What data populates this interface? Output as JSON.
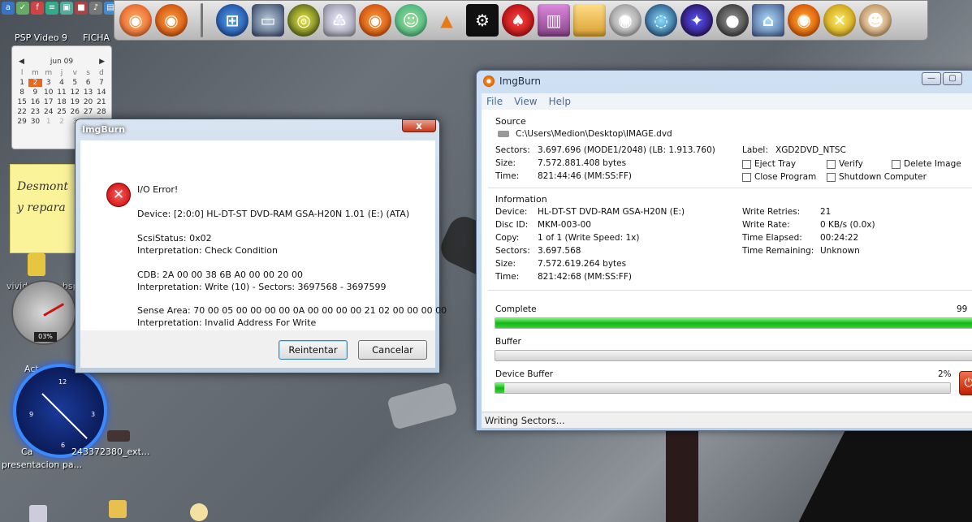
{
  "desktop": {
    "labels": {
      "psp_video": "PSP Video 9",
      "ficha": "FICHA",
      "vivid": "vivid_mgic...bsp",
      "act": "Act",
      "ca": "Ca",
      "file_ext": "243372380_ext...",
      "presentacion": "presentacion pa..."
    },
    "sticky_note": {
      "line1": "Desmont",
      "line2": "y repara"
    },
    "meter_value": "03%",
    "calendar": {
      "month": "jun 09",
      "days_of_week": [
        "l",
        "m",
        "m",
        "j",
        "v",
        "s",
        "d"
      ],
      "weeks": [
        [
          "1",
          "2",
          "3",
          "4",
          "5",
          "6",
          "7"
        ],
        [
          "8",
          "9",
          "10",
          "11",
          "12",
          "13",
          "14"
        ],
        [
          "15",
          "16",
          "17",
          "18",
          "19",
          "20",
          "21"
        ],
        [
          "22",
          "23",
          "24",
          "25",
          "26",
          "27",
          "28"
        ],
        [
          "29",
          "30",
          "1",
          "2",
          "3",
          "4",
          "5"
        ]
      ],
      "today": "2"
    },
    "dock_icons": [
      "firefox-orange-icon",
      "firefox-icon",
      "windows-start-icon",
      "computer-icon",
      "media-icon",
      "recycle-bin-icon",
      "firefox-alt-icon",
      "messenger-icon",
      "vlc-icon",
      "steam-icon",
      "poker-icon",
      "winrar-icon",
      "folder-icon",
      "disc-tool-icon",
      "swirl-icon",
      "games-icon",
      "webcam-icon",
      "network-icon",
      "burner-icon",
      "tools-icon",
      "cow-icon"
    ]
  },
  "imgburn": {
    "title": "ImgBurn",
    "menu": [
      "File",
      "View",
      "Help"
    ],
    "source": {
      "heading": "Source",
      "path": "C:\\Users\\Medion\\Desktop\\IMAGE.dvd",
      "sectors_label": "Sectors:",
      "sectors_value": "3.697.696 (MODE1/2048) (LB: 1.913.760)",
      "size_label": "Size:",
      "size_value": "7.572.881.408 bytes",
      "time_label": "Time:",
      "time_value": "821:44:46 (MM:SS:FF)",
      "disc_label_label": "Label:",
      "disc_label_value": "XGD2DVD_NTSC",
      "options": [
        "Eject Tray",
        "Verify",
        "Delete Image",
        "Close Program",
        "Shutdown Computer"
      ]
    },
    "information": {
      "heading": "Information",
      "device_label": "Device:",
      "device_value": "HL-DT-ST DVD-RAM GSA-H20N (E:)",
      "discid_label": "Disc ID:",
      "discid_value": "MKM-003-00",
      "copy_label": "Copy:",
      "copy_value": "1 of 1 (Write Speed: 1x)",
      "sectors_label": "Sectors:",
      "sectors_value": "3.697.568",
      "size_label": "Size:",
      "size_value": "7.572.619.264 bytes",
      "time_label": "Time:",
      "time_value": "821:42:68 (MM:SS:FF)",
      "retries_label": "Write Retries:",
      "retries_value": "21",
      "rate_label": "Write Rate:",
      "rate_value": "0 KB/s (0.0x)",
      "elapsed_label": "Time Elapsed:",
      "elapsed_value": "00:24:22",
      "remaining_label": "Time Remaining:",
      "remaining_value": "Unknown"
    },
    "progress": {
      "complete_label": "Complete",
      "complete_pct_text": "99",
      "complete_value": 0.99,
      "buffer_label": "Buffer",
      "buffer_value": 0,
      "device_buffer_label": "Device Buffer",
      "device_buffer_pct_text": "2%",
      "device_buffer_value": 0.02
    },
    "status": "Writing Sectors..."
  },
  "error_dialog": {
    "title": "ImgBurn",
    "close": "x",
    "lines": {
      "error": "I/O Error!",
      "device": "Device: [2:0:0] HL-DT-ST DVD-RAM GSA-H20N 1.01 (E:) (ATA)",
      "scsi_status": "ScsiStatus: 0x02",
      "interp1": "Interpretation: Check Condition",
      "cdb": "CDB: 2A 00 00 38 6B A0 00 00 20 00",
      "interp2": "Interpretation: Write (10) - Sectors: 3697568 - 3697599",
      "sense": "Sense Area: 70 00 05 00 00 00 00 0A 00 00 00 00 21 02 00 00 00 00",
      "interp3": "Interpretation: Invalid Address For Write"
    },
    "retry_button": "Reintentar",
    "cancel_button": "Cancelar"
  },
  "colors": {
    "progress_green": "#15b515",
    "error_red": "#c00000",
    "accent_blue": "#4a6b94"
  }
}
